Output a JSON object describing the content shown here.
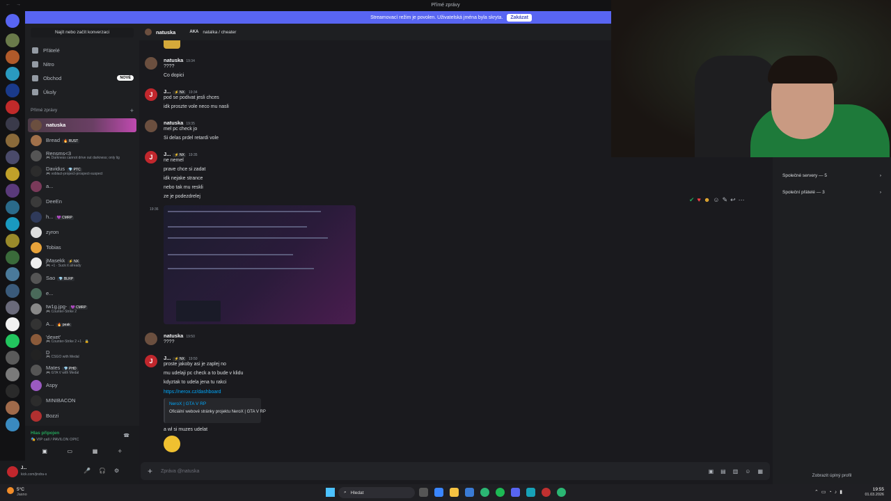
{
  "titlebar": {
    "title": "Přímé zprávy",
    "nav": "← →"
  },
  "banner": {
    "text": "Streamovací režim je povolen. Uživatelská jména byla skryta.",
    "button": "Zakázat"
  },
  "dmlist": {
    "search": "Najít nebo začít konverzaci",
    "nav": [
      {
        "label": "Přátelé"
      },
      {
        "label": "Nitro"
      },
      {
        "label": "Obchod",
        "badge": "NOVÉ"
      },
      {
        "label": "Úkoly"
      }
    ],
    "section": "Přímé zprávy",
    "items": [
      {
        "name": "natuska",
        "status": "",
        "tag": "",
        "color": "#6b4f3f",
        "active": true
      },
      {
        "name": "Bread",
        "status": "",
        "tag": "🔥 RUST",
        "color": "#a0704a"
      },
      {
        "name": "Rensms<3",
        "status": "🎮 Darkness cannot drive out darkness; only lig",
        "tag": "",
        "color": "#555"
      },
      {
        "name": "Davidus",
        "status": "🎮 voblact-propect-prospect-suspect",
        "tag": "💎 PTC",
        "color": "#2c2c2c"
      },
      {
        "name": "a...",
        "status": "",
        "tag": "",
        "color": "#7a3a5a"
      },
      {
        "name": "DeeEn",
        "status": "",
        "tag": "",
        "color": "#3a3a3a"
      },
      {
        "name": "h...",
        "status": "",
        "tag": "💜 CMRP",
        "color": "#2f3a5a"
      },
      {
        "name": "zyron",
        "status": "",
        "tag": "",
        "color": "#dddddd"
      },
      {
        "name": "Tobias",
        "status": "",
        "tag": "",
        "color": "#e8a33a"
      },
      {
        "name": "jMasekk",
        "status": "🎮 +1 · Suck it already",
        "tag": "⚡ NX",
        "color": "#eeeeee"
      },
      {
        "name": "Sao",
        "status": "",
        "tag": "💎 BLRP",
        "color": "#555555"
      },
      {
        "name": "e...",
        "status": "",
        "tag": "",
        "color": "#4a6a5a"
      },
      {
        "name": "tw1g.jpg-",
        "status": "🎮 Counter-Strike 2",
        "tag": "💜 CMRP",
        "color": "#888888"
      },
      {
        "name": "A...",
        "status": "",
        "tag": "🔥 peak",
        "color": "#333333"
      },
      {
        "name": "'dexet'",
        "status": "🎮 Counter-Strike 2 +1 · 🔒",
        "tag": "",
        "color": "#8a5a3a"
      },
      {
        "name": "D",
        "status": "🎮 CSGO with Medal",
        "tag": "",
        "color": "#222222"
      },
      {
        "name": "Mates",
        "status": "🎮 GTA V with Medal",
        "tag": "💎 PHD",
        "color": "#555555"
      },
      {
        "name": "Aspy",
        "status": "",
        "tag": "",
        "color": "#9a5ac0"
      },
      {
        "name": "MINIBACON",
        "status": "",
        "tag": "",
        "color": "#2c2c2c"
      },
      {
        "name": "Bozzi",
        "status": "",
        "tag": "",
        "color": "#b03030"
      }
    ]
  },
  "voice": {
    "title": "Hlas připojen",
    "sub": "🎭 VIP call / PAVILON OPIC"
  },
  "user": {
    "name": "J...",
    "status": "kick.com/jindra-s"
  },
  "header": {
    "name": "natuska",
    "aka_label": "AKA",
    "aka": "natalka / cheater"
  },
  "messages": [
    {
      "author": "natuska",
      "time": "19:34",
      "lines": [
        "????",
        "Co dopici"
      ],
      "jav": false
    },
    {
      "author": "J...",
      "tag": "⚡ NX",
      "time": "19:34",
      "lines": [
        "pod se podivat jesli chces",
        "idk proszte vole neco mu nasli"
      ],
      "jav": true
    },
    {
      "author": "natuska",
      "time": "19:35",
      "lines": [
        "mel pc check jo",
        "Si delas prdel retardi vole"
      ],
      "jav": false
    },
    {
      "author": "J...",
      "tag": "⚡ NX",
      "time": "19:35",
      "lines": [
        "ne nemel",
        "prave chce si zadat",
        "idk nejake strance",
        "nebo tak mu reskli",
        "ze je podezdrelej"
      ],
      "jav": true
    },
    {
      "author": "natuska",
      "time": "19:50",
      "lines": [
        "????"
      ],
      "jav": false
    },
    {
      "author": "J...",
      "tag": "⚡ NX",
      "time": "19:50",
      "lines": [
        "proste jakoby asi je zaplej no",
        "mu udelaji pc check a to bude v klidu",
        "kdyztak to udela jena tu rakci"
      ],
      "jav": true
    }
  ],
  "screenshot_time": "19:36",
  "link": "https://nerox.cz/dashboard",
  "embed": {
    "title": "NeroX | GTA V RP",
    "desc": "Oficiální webové stránky projektu NeroX | GTA V RP"
  },
  "after_embed": "a wl si muzes udelat",
  "composer": {
    "placeholder": "Zpráva @natuska"
  },
  "profile": {
    "servers": "Společné servery — 5",
    "friends": "Společní přátelé — 3",
    "full": "Zobrazit úplný profil"
  },
  "taskbar": {
    "temp": "5°C",
    "weather": "Jasno",
    "search": "Hledat",
    "time": "19:55",
    "date": "01.03.2026"
  }
}
